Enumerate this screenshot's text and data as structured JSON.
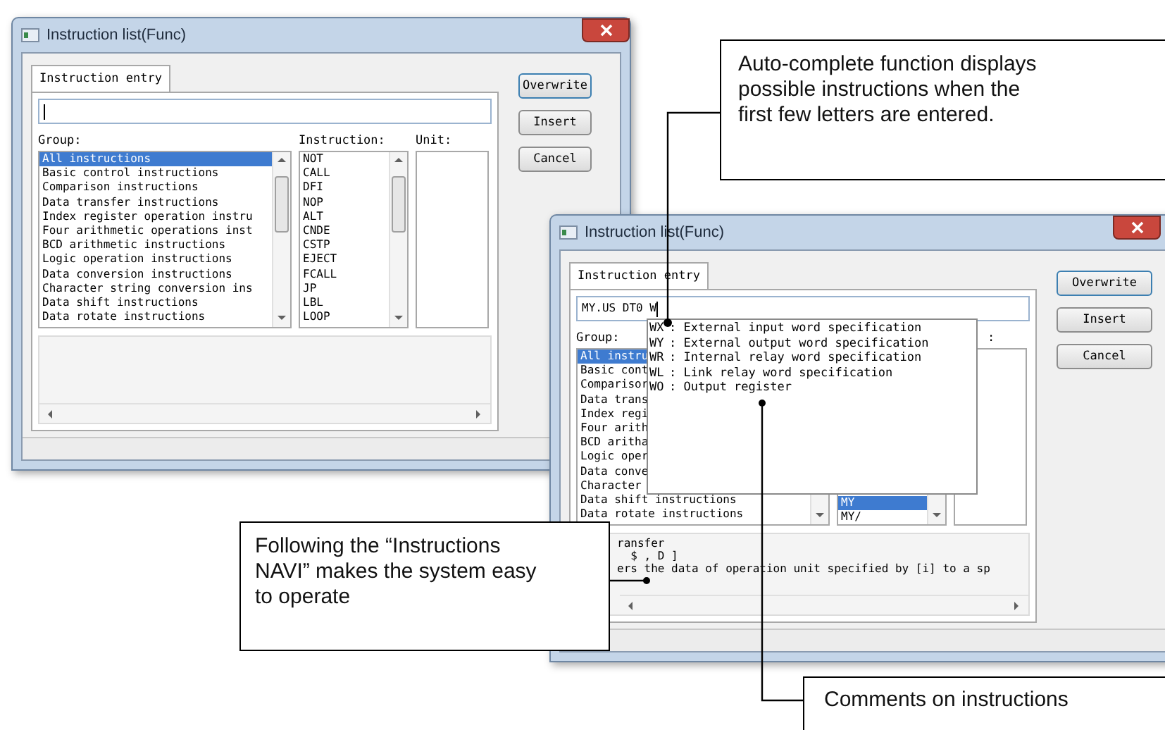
{
  "windows": [
    {
      "title": "Instruction list(Func)",
      "tab": {
        "label": "Instruction entry",
        "selected": true
      },
      "group_label": "Group:",
      "instruction_label": "Instruction:",
      "unit_label": "Unit:",
      "groups": [
        {
          "label": "All instructions",
          "selected": true
        },
        {
          "label": "Basic control instructions",
          "selected": false
        },
        {
          "label": "Comparison instructions",
          "selected": false
        },
        {
          "label": "Data transfer instructions",
          "selected": false
        },
        {
          "label": "Index register operation instru",
          "selected": false
        },
        {
          "label": "Four arithmetic operations inst",
          "selected": false
        },
        {
          "label": "BCD arithmetic instructions",
          "selected": false
        },
        {
          "label": "Logic operation instructions",
          "selected": false
        },
        {
          "label": "Data conversion instructions",
          "selected": false
        },
        {
          "label": "Character string conversion ins",
          "selected": false
        },
        {
          "label": "Data shift instructions",
          "selected": false
        },
        {
          "label": "Data rotate instructions",
          "selected": false
        }
      ],
      "instructions": [
        {
          "label": "NOT",
          "selected": false
        },
        {
          "label": "CALL",
          "selected": false
        },
        {
          "label": "DFI",
          "selected": false
        },
        {
          "label": "NOP",
          "selected": false
        },
        {
          "label": "ALT",
          "selected": false
        },
        {
          "label": "CNDE",
          "selected": false
        },
        {
          "label": "CSTP",
          "selected": false
        },
        {
          "label": "EJECT",
          "selected": false
        },
        {
          "label": "FCALL",
          "selected": false
        },
        {
          "label": "JP",
          "selected": false
        },
        {
          "label": "LBL",
          "selected": false
        },
        {
          "label": "LOOP",
          "selected": false
        }
      ],
      "buttons": [
        "Overwrite",
        "Insert",
        "Cancel"
      ]
    },
    {
      "title": "Instruction list(Func)",
      "tab": {
        "label": "Instruction entry",
        "selected": true
      },
      "entry": {
        "value": "MY.US DT0 W"
      },
      "group_label": "Group:",
      "unit_label": ":",
      "groups": [
        {
          "label": "All instru",
          "selected": true
        },
        {
          "label": "Basic cont",
          "selected": false
        },
        {
          "label": "Comparisor",
          "selected": false
        },
        {
          "label": "Data trans",
          "selected": false
        },
        {
          "label": "Index regi",
          "selected": false
        },
        {
          "label": "Four arith",
          "selected": false
        },
        {
          "label": "BCD aritha",
          "selected": false
        },
        {
          "label": "Logic oper",
          "selected": false
        },
        {
          "label": "Data conve",
          "selected": false
        },
        {
          "label": "Character",
          "selected": false
        },
        {
          "label": "Data shift instructions",
          "selected": false
        },
        {
          "label": "Data rotate instructions",
          "selected": false
        }
      ],
      "instructions": [
        {
          "label": "MY",
          "selected": true
        },
        {
          "label": "MY/",
          "selected": false
        }
      ],
      "autocomplete": [
        {
          "code": "WX",
          "text": ": External input word specification"
        },
        {
          "code": "WY",
          "text": ": External output word specification"
        },
        {
          "code": "WR",
          "text": ": Internal relay word specification"
        },
        {
          "code": "WL",
          "text": ": Link relay word specification"
        },
        {
          "code": "WO",
          "text": ": Output register"
        }
      ],
      "comment": [
        "ransfer",
        "  $ , D ]",
        "ers the data of operation unit specified by [i] to a sp"
      ],
      "buttons": [
        "Overwrite",
        "Insert",
        "Cancel"
      ]
    }
  ],
  "callouts": [
    "Auto-complete function displays possible instructions when the first few letters are entered.",
    "Following the “Instructions NAVI” makes the system easy to operate",
    "Comments on instructions"
  ]
}
